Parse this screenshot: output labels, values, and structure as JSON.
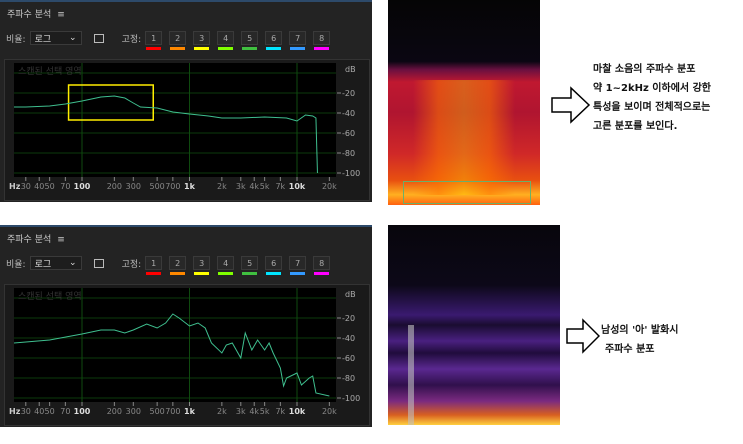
{
  "panels": [
    {
      "title": "주파수 분석",
      "scale_label": "비율:",
      "scale_value": "로그",
      "fix_label": "고정:",
      "slots": [
        "1",
        "2",
        "3",
        "4",
        "5",
        "6",
        "7",
        "8"
      ],
      "overlay": "스캔된 선택 영역",
      "db_unit": "dB",
      "hz_unit": "Hz"
    },
    {
      "title": "주파수 분석",
      "scale_label": "비율:",
      "scale_value": "로그",
      "fix_label": "고정:",
      "slots": [
        "1",
        "2",
        "3",
        "4",
        "5",
        "6",
        "7",
        "8"
      ],
      "overlay": "스캔된 선택 영역",
      "db_unit": "dB",
      "hz_unit": "Hz"
    }
  ],
  "slot_colors": [
    "#ff0000",
    "#ff8800",
    "#ffff00",
    "#80ff00",
    "#40c040",
    "#00e5ff",
    "#3399ff",
    "#ff00ff"
  ],
  "notes": {
    "top": [
      "마찰 소음의 주파수 분포",
      "약 1~2kHz 이하에서 강한",
      "특성을 보이며 전체적으로는",
      "고른 분포를 보인다."
    ],
    "bottom": [
      "남성의 '아' 발화시",
      "주파수 분포"
    ]
  },
  "chart_data": [
    {
      "type": "line",
      "xscale": "log",
      "xlabel": "Hz",
      "ylabel": "dB",
      "xlim": [
        20,
        22000
      ],
      "ylim": [
        -105,
        0
      ],
      "x_ticks": [
        "30",
        "40",
        "50",
        "70",
        "100",
        "200",
        "300",
        "500",
        "700",
        "1k",
        "2k",
        "3k",
        "4k",
        "5k",
        "7k",
        "10k",
        "20k"
      ],
      "x_tick_values": [
        30,
        40,
        50,
        70,
        100,
        200,
        300,
        500,
        700,
        1000,
        2000,
        3000,
        4000,
        5000,
        7000,
        10000,
        20000
      ],
      "y_ticks": [
        "-20",
        "-40",
        "-60",
        "-80",
        "-100"
      ],
      "y_tick_values": [
        -20,
        -40,
        -60,
        -80,
        -100
      ],
      "highlight_box": {
        "x_range": [
          75,
          460
        ],
        "y_range": [
          -12,
          -47
        ],
        "color": "#ffee00"
      },
      "series": [
        {
          "name": "마찰 소음",
          "color": "#3fbf8f",
          "points": [
            [
              20,
              -34
            ],
            [
              30,
              -34
            ],
            [
              50,
              -33
            ],
            [
              70,
              -31
            ],
            [
              100,
              -28
            ],
            [
              150,
              -24
            ],
            [
              200,
              -23
            ],
            [
              250,
              -25
            ],
            [
              300,
              -30
            ],
            [
              350,
              -34
            ],
            [
              500,
              -35
            ],
            [
              700,
              -39
            ],
            [
              1000,
              -41
            ],
            [
              1500,
              -43
            ],
            [
              2000,
              -45
            ],
            [
              3000,
              -45
            ],
            [
              5000,
              -44
            ],
            [
              8000,
              -45
            ],
            [
              10000,
              -48
            ],
            [
              12000,
              -42
            ],
            [
              14000,
              -43
            ],
            [
              15000,
              -45
            ],
            [
              15500,
              -100
            ]
          ]
        }
      ]
    },
    {
      "type": "line",
      "xscale": "log",
      "xlabel": "Hz",
      "ylabel": "dB",
      "xlim": [
        20,
        22000
      ],
      "ylim": [
        -105,
        0
      ],
      "x_ticks": [
        "30",
        "40",
        "50",
        "70",
        "100",
        "200",
        "300",
        "500",
        "700",
        "1k",
        "2k",
        "3k",
        "4k",
        "5k",
        "7k",
        "10k",
        "20k"
      ],
      "x_tick_values": [
        30,
        40,
        50,
        70,
        100,
        200,
        300,
        500,
        700,
        1000,
        2000,
        3000,
        4000,
        5000,
        7000,
        10000,
        20000
      ],
      "y_ticks": [
        "-20",
        "-40",
        "-60",
        "-80",
        "-100"
      ],
      "y_tick_values": [
        -20,
        -40,
        -60,
        -80,
        -100
      ],
      "series": [
        {
          "name": "남성 '아' 발화",
          "color": "#3fbf8f",
          "points": [
            [
              20,
              -45
            ],
            [
              50,
              -42
            ],
            [
              100,
              -36
            ],
            [
              150,
              -32
            ],
            [
              200,
              -32
            ],
            [
              250,
              -35
            ],
            [
              300,
              -32
            ],
            [
              400,
              -26
            ],
            [
              500,
              -30
            ],
            [
              600,
              -25
            ],
            [
              700,
              -16
            ],
            [
              800,
              -20
            ],
            [
              1000,
              -28
            ],
            [
              1200,
              -25
            ],
            [
              1400,
              -30
            ],
            [
              1600,
              -45
            ],
            [
              2000,
              -55
            ],
            [
              2200,
              -47
            ],
            [
              2500,
              -45
            ],
            [
              3000,
              -60
            ],
            [
              3300,
              -35
            ],
            [
              3800,
              -52
            ],
            [
              4300,
              -42
            ],
            [
              5000,
              -52
            ],
            [
              5500,
              -45
            ],
            [
              6000,
              -55
            ],
            [
              7000,
              -70
            ],
            [
              7500,
              -88
            ],
            [
              8000,
              -80
            ],
            [
              10000,
              -75
            ],
            [
              11000,
              -87
            ],
            [
              13000,
              -80
            ],
            [
              14000,
              -78
            ],
            [
              15000,
              -95
            ],
            [
              20000,
              -98
            ]
          ]
        }
      ]
    }
  ]
}
